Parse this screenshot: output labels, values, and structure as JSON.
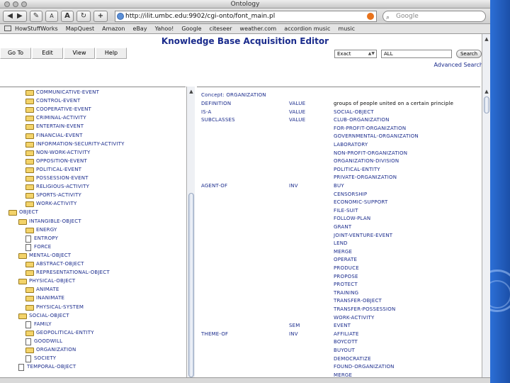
{
  "window": {
    "title": "Ontology"
  },
  "toolbar": {
    "url": "http://ilit.umbc.edu:9902/cgi-onto/font_main.pl",
    "search_placeholder": "Google",
    "font_smaller": "A",
    "font_larger": "A",
    "add_label": "+"
  },
  "bookmarks": [
    "HowStuffWorks",
    "MapQuest",
    "Amazon",
    "eBay",
    "Yahoo!",
    "Google",
    "citeseer",
    "weather.com",
    "accordion music",
    "music"
  ],
  "app": {
    "title": "Knowledge Base Acquisition Editor",
    "menu": [
      "Go To",
      "Edit",
      "View",
      "Help"
    ],
    "search_mode": "Exact",
    "search_value": "ALL",
    "search_button": "Search",
    "advanced_search": "Advanced Search"
  },
  "tree": [
    {
      "label": "COMMUNICATIVE-EVENT",
      "depth": 3,
      "kind": "folder"
    },
    {
      "label": "CONTROL-EVENT",
      "depth": 3,
      "kind": "folder"
    },
    {
      "label": "COOPERATIVE-EVENT",
      "depth": 3,
      "kind": "folder"
    },
    {
      "label": "CRIMINAL-ACTIVITY",
      "depth": 3,
      "kind": "folder"
    },
    {
      "label": "ENTERTAIN-EVENT",
      "depth": 3,
      "kind": "folder"
    },
    {
      "label": "FINANCIAL-EVENT",
      "depth": 3,
      "kind": "folder"
    },
    {
      "label": "INFORMATION-SECURITY-ACTIVITY",
      "depth": 3,
      "kind": "folder"
    },
    {
      "label": "NON-WORK-ACTIVITY",
      "depth": 3,
      "kind": "folder"
    },
    {
      "label": "OPPOSITION-EVENT",
      "depth": 3,
      "kind": "folder"
    },
    {
      "label": "POLITICAL-EVENT",
      "depth": 3,
      "kind": "folder"
    },
    {
      "label": "POSSESSION-EVENT",
      "depth": 3,
      "kind": "folder"
    },
    {
      "label": "RELIGIOUS-ACTIVITY",
      "depth": 3,
      "kind": "folder"
    },
    {
      "label": "SPORTS-ACTIVITY",
      "depth": 3,
      "kind": "folder"
    },
    {
      "label": "WORK-ACTIVITY",
      "depth": 3,
      "kind": "folder"
    },
    {
      "label": "OBJECT",
      "depth": 1,
      "kind": "folder"
    },
    {
      "label": "INTANGIBLE-OBJECT",
      "depth": 2,
      "kind": "folder"
    },
    {
      "label": "ENERGY",
      "depth": 3,
      "kind": "folder"
    },
    {
      "label": "ENTROPY",
      "depth": 3,
      "kind": "doc"
    },
    {
      "label": "FORCE",
      "depth": 3,
      "kind": "doc"
    },
    {
      "label": "MENTAL-OBJECT",
      "depth": 2,
      "kind": "folder"
    },
    {
      "label": "ABSTRACT-OBJECT",
      "depth": 3,
      "kind": "folder"
    },
    {
      "label": "REPRESENTATIONAL-OBJECT",
      "depth": 3,
      "kind": "folder"
    },
    {
      "label": "PHYSICAL-OBJECT",
      "depth": 2,
      "kind": "folder"
    },
    {
      "label": "ANIMATE",
      "depth": 3,
      "kind": "folder"
    },
    {
      "label": "INANIMATE",
      "depth": 3,
      "kind": "folder"
    },
    {
      "label": "PHYSICAL-SYSTEM",
      "depth": 3,
      "kind": "folder"
    },
    {
      "label": "SOCIAL-OBJECT",
      "depth": 2,
      "kind": "folder"
    },
    {
      "label": "FAMILY",
      "depth": 3,
      "kind": "doc"
    },
    {
      "label": "GEOPOLITICAL-ENTITY",
      "depth": 3,
      "kind": "folder"
    },
    {
      "label": "GOODWILL",
      "depth": 3,
      "kind": "doc"
    },
    {
      "label": "ORGANIZATION",
      "depth": 3,
      "kind": "folder"
    },
    {
      "label": "SOCIETY",
      "depth": 3,
      "kind": "doc"
    },
    {
      "label": "TEMPORAL-OBJECT",
      "depth": 2,
      "kind": "doc"
    }
  ],
  "concept": {
    "header": "Concept: ORGANIZATION",
    "rows": [
      {
        "prop": "DEFINITION",
        "facet": "VALUE",
        "filler": "groups of people united on a certain principle",
        "filler_black": true
      },
      {
        "prop": "IS-A",
        "facet": "VALUE",
        "filler": "SOCIAL-OBJECT"
      },
      {
        "prop": "SUBCLASSES",
        "facet": "VALUE",
        "filler": "CLUB-ORGANIZATION"
      },
      {
        "prop": "",
        "facet": "",
        "filler": "FOR-PROFIT-ORGANIZATION"
      },
      {
        "prop": "",
        "facet": "",
        "filler": "GOVERNMENTAL-ORGANIZATION"
      },
      {
        "prop": "",
        "facet": "",
        "filler": "LABORATORY"
      },
      {
        "prop": "",
        "facet": "",
        "filler": "NON-PROFIT-ORGANIZATION"
      },
      {
        "prop": "",
        "facet": "",
        "filler": "ORGANIZATION-DIVISION"
      },
      {
        "prop": "",
        "facet": "",
        "filler": "POLITICAL-ENTITY"
      },
      {
        "prop": "",
        "facet": "",
        "filler": "PRIVATE-ORGANIZATION"
      },
      {
        "prop": "AGENT-OF",
        "facet": "INV",
        "filler": "BUY"
      },
      {
        "prop": "",
        "facet": "",
        "filler": "CENSORSHIP"
      },
      {
        "prop": "",
        "facet": "",
        "filler": "ECONOMIC-SUPPORT"
      },
      {
        "prop": "",
        "facet": "",
        "filler": "FILE-SUIT"
      },
      {
        "prop": "",
        "facet": "",
        "filler": "FOLLOW-PLAN"
      },
      {
        "prop": "",
        "facet": "",
        "filler": "GRANT"
      },
      {
        "prop": "",
        "facet": "",
        "filler": "JOINT-VENTURE-EVENT"
      },
      {
        "prop": "",
        "facet": "",
        "filler": "LEND"
      },
      {
        "prop": "",
        "facet": "",
        "filler": "MERGE"
      },
      {
        "prop": "",
        "facet": "",
        "filler": "OPERATE"
      },
      {
        "prop": "",
        "facet": "",
        "filler": "PRODUCE"
      },
      {
        "prop": "",
        "facet": "",
        "filler": "PROPOSE"
      },
      {
        "prop": "",
        "facet": "",
        "filler": "PROTECT"
      },
      {
        "prop": "",
        "facet": "",
        "filler": "TRAINING"
      },
      {
        "prop": "",
        "facet": "",
        "filler": "TRANSFER-OBJECT"
      },
      {
        "prop": "",
        "facet": "",
        "filler": "TRANSFER-POSSESSION"
      },
      {
        "prop": "",
        "facet": "",
        "filler": "WORK-ACTIVITY"
      },
      {
        "prop": "",
        "facet": "SEM",
        "filler": "EVENT"
      },
      {
        "prop": "THEME-OF",
        "facet": "INV",
        "filler": "AFFILIATE"
      },
      {
        "prop": "",
        "facet": "",
        "filler": "BOYCOTT"
      },
      {
        "prop": "",
        "facet": "",
        "filler": "BUYOUT"
      },
      {
        "prop": "",
        "facet": "",
        "filler": "DEMOCRATIZE"
      },
      {
        "prop": "",
        "facet": "",
        "filler": "FOUND-ORGANIZATION"
      },
      {
        "prop": "",
        "facet": "",
        "filler": "MERGE"
      }
    ]
  },
  "colors": {
    "link": "#1a2b8c",
    "folder": "#f3d36a",
    "desktop": "#2c6fd6"
  },
  "icons": [
    "back-icon",
    "forward-icon",
    "edit-icon",
    "reload-icon",
    "add-icon",
    "globe-icon",
    "rss-icon",
    "search-icon",
    "bookmark-book-icon",
    "folder-icon",
    "document-icon"
  ]
}
